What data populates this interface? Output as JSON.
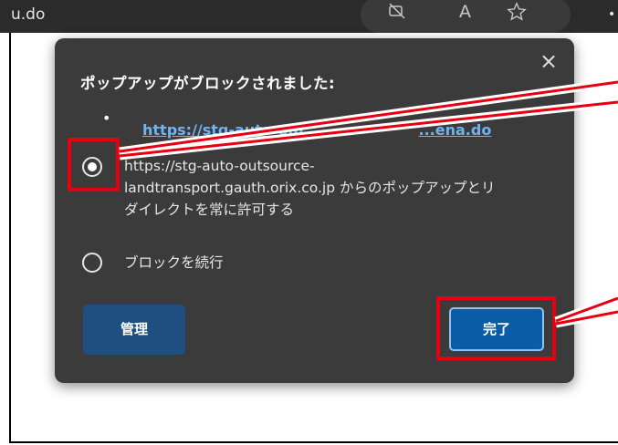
{
  "browser": {
    "url_tail": "u.do",
    "icons": [
      "no-camera-icon",
      "read-aloud-icon",
      "favorite-star-icon",
      "more-icon"
    ],
    "read_aloud_label": "A"
  },
  "popup": {
    "title": "ポップアップがブロックされました:",
    "close_label": "×",
    "bullet": "•",
    "blocked_link_start": "https://stg-auto-out",
    "blocked_link_end": "...ena.do",
    "options": [
      {
        "line1": "https://stg-auto-outsource-",
        "line2": "landtransport.gauth.orix.co.jp からのポップアップとリ",
        "line3": "ダイレクトを常に許可する",
        "selected": true
      },
      {
        "label": "ブロックを続行",
        "selected": false
      }
    ],
    "manage_label": "管理",
    "done_label": "完了"
  },
  "colors": {
    "popup_bg": "#3b3b3b",
    "link": "#6fb3f0",
    "primary_button": "#0a5ca6",
    "secondary_button": "#1e4f80",
    "highlight": "#e60012"
  }
}
